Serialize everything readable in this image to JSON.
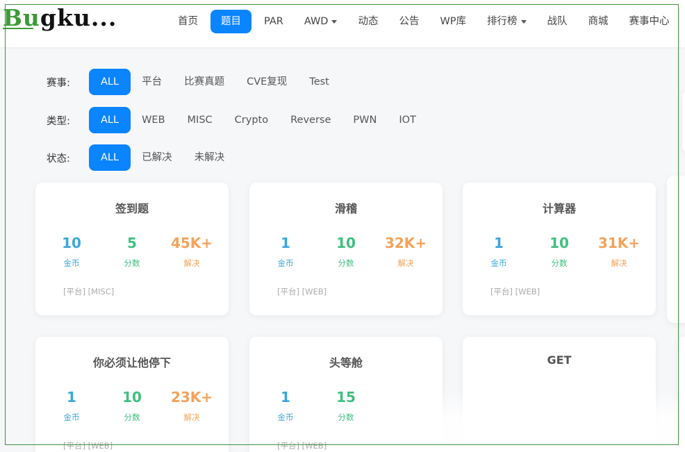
{
  "logo": {
    "text_a": "B",
    "text_b": "u",
    "text_c": "g",
    "text_d": "ku",
    "text_e": "..."
  },
  "nav": {
    "items": [
      {
        "label": "首页"
      },
      {
        "label": "题目"
      },
      {
        "label": "PAR"
      },
      {
        "label": "AWD"
      },
      {
        "label": "动态"
      },
      {
        "label": "公告"
      },
      {
        "label": "WP库"
      },
      {
        "label": "排行榜"
      },
      {
        "label": "战队"
      },
      {
        "label": "商城"
      },
      {
        "label": "赛事中心"
      }
    ]
  },
  "filters": {
    "event": {
      "label": "赛事:",
      "options": [
        "ALL",
        "平台",
        "比赛真题",
        "CVE复现",
        "Test"
      ]
    },
    "type": {
      "label": "类型:",
      "options": [
        "ALL",
        "WEB",
        "MISC",
        "Crypto",
        "Reverse",
        "PWN",
        "IOT"
      ]
    },
    "status": {
      "label": "状态:",
      "options": [
        "ALL",
        "已解决",
        "未解决"
      ]
    }
  },
  "stat_labels": {
    "coins": "金币",
    "score": "分数",
    "solved": "解决"
  },
  "cards": [
    {
      "title": "签到题",
      "coins": "10",
      "score": "5",
      "solved": "45K+",
      "tags": "[平台] [MISC]"
    },
    {
      "title": "滑稽",
      "coins": "1",
      "score": "10",
      "solved": "32K+",
      "tags": "[平台] [WEB]"
    },
    {
      "title": "计算器",
      "coins": "1",
      "score": "10",
      "solved": "31K+",
      "tags": "[平台] [WEB]"
    },
    {
      "title": "你必须让他停下",
      "coins": "1",
      "score": "10",
      "solved": "23K+",
      "tags": "[平台] [WEB]"
    },
    {
      "title": "头等舱",
      "coins": "1",
      "score": "15",
      "solved": "",
      "tags": "[平台] [WEB]"
    },
    {
      "title": "GET",
      "coins": "",
      "score": "",
      "solved": "",
      "tags": ""
    }
  ]
}
